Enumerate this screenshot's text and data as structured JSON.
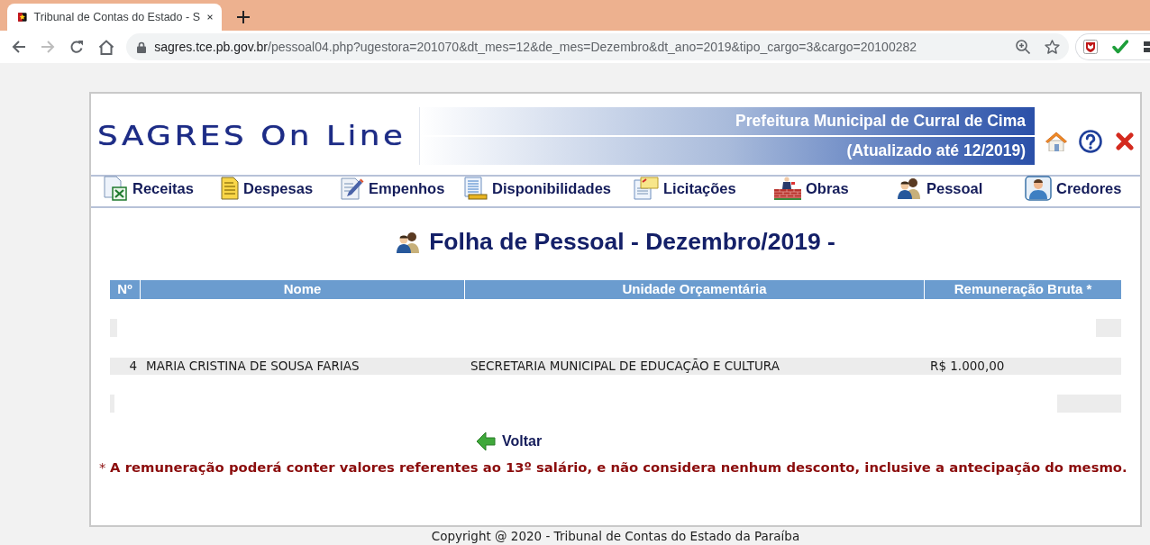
{
  "browser": {
    "tab": {
      "title": "Tribunal de Contas do Estado - S",
      "selected": true
    },
    "url": {
      "host": "sagres.tce.pb.gov.br",
      "path": "/pessoal04.php?ugestora=201070&dt_mes=12&de_mes=Dezembro&dt_ano=2019&tipo_cargo=3&cargo=20100282"
    }
  },
  "header": {
    "logo": "SAGRES On Line",
    "banner_lines": [
      "Prefeitura Municipal de Curral de Cima",
      "(Atualizado até 12/2019)"
    ]
  },
  "nav": [
    "Receitas",
    "Despesas",
    "Empenhos",
    "Disponibilidades",
    "Licitações",
    "Obras",
    "Pessoal",
    "Credores"
  ],
  "title": "Folha de Pessoal - Dezembro/2019 -",
  "table": {
    "columns": [
      "Nº",
      "Nome",
      "Unidade Orçamentária",
      "Remuneração Bruta *"
    ],
    "rows": [
      {
        "cells": [
          "4",
          "MARIA CRISTINA DE SOUSA FARIAS",
          "SECRETARIA MUNICIPAL DE EDUCAÇÃO E CULTURA",
          "R$ 1.000,00"
        ]
      }
    ]
  },
  "back_link": "Voltar",
  "footnote": "* **A remuneração poderá conter valores referentes ao 13º salário, e não considera nenhum desconto, inclusive a antecipação do mesmo.**",
  "footer": "Copyright @ 2020 - Tribunal de Contas do Estado da Paraíba"
}
